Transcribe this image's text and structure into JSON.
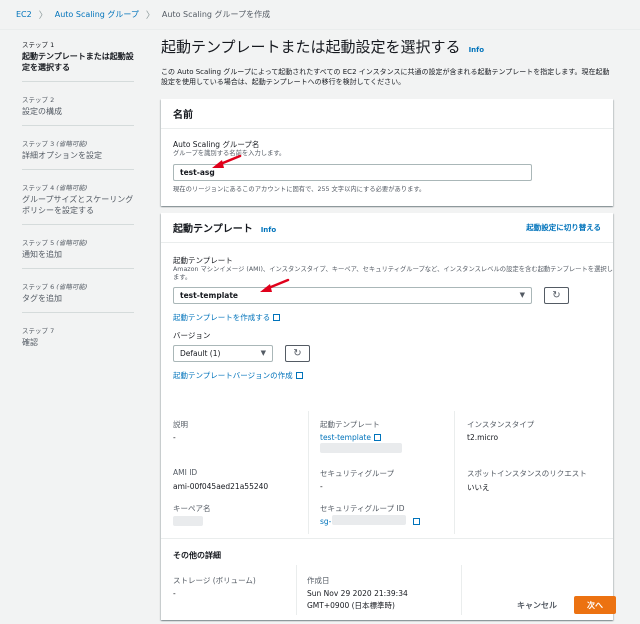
{
  "breadcrumb": {
    "items": [
      "EC2",
      "Auto Scaling グループ"
    ],
    "current": "Auto Scaling グループを作成"
  },
  "steps": [
    {
      "num": "ステップ 1",
      "optional": "",
      "title": "起動テンプレートまたは起動設定を選択する"
    },
    {
      "num": "ステップ 2",
      "optional": "",
      "title": "設定の構成"
    },
    {
      "num": "ステップ 3",
      "optional": "(省略可能)",
      "title": "詳細オプションを設定"
    },
    {
      "num": "ステップ 4",
      "optional": "(省略可能)",
      "title": "グループサイズとスケーリングポリシーを設定する"
    },
    {
      "num": "ステップ 5",
      "optional": "(省略可能)",
      "title": "通知を追加"
    },
    {
      "num": "ステップ 6",
      "optional": "(省略可能)",
      "title": "タグを追加"
    },
    {
      "num": "ステップ 7",
      "optional": "",
      "title": "確認"
    }
  ],
  "page": {
    "title": "起動テンプレートまたは起動設定を選択する",
    "info": "Info",
    "description": "この Auto Scaling グループによって起動されたすべての EC2 インスタンスに共通の設定が含まれる起動テンプレートを指定します。現在起動設定を使用している場合は、起動テンプレートへの移行を検討してください。"
  },
  "name_card": {
    "header": "名前",
    "label": "Auto Scaling グループ名",
    "hint": "グループを識別する名前を入力します。",
    "value": "test-asg",
    "constraint": "現在のリージョンにあるこのアカウントに固有で、255 文字以内にする必要があります。"
  },
  "template_card": {
    "header": "起動テンプレート",
    "info": "Info",
    "switch_link": "起動設定に切り替える",
    "label": "起動テンプレート",
    "hint": "Amazon マシンイメージ (AMI)、インスタンスタイプ、キーペア、セキュリティグループなど、インスタンスレベルの設定を含む起動テンプレートを選択します。",
    "selected": "test-template",
    "create_link": "起動テンプレートを作成する",
    "version_label": "バージョン",
    "version_selected": "Default (1)",
    "create_version_link": "起動テンプレートバージョンの作成",
    "details": {
      "description_label": "説明",
      "description_value": "-",
      "template_label": "起動テンプレート",
      "template_value": "test-template",
      "instance_type_label": "インスタンスタイプ",
      "instance_type_value": "t2.micro",
      "ami_label": "AMI ID",
      "ami_value": "ami-00f045aed21a55240",
      "sg_label": "セキュリティグループ",
      "sg_value": "-",
      "spot_label": "スポットインスタンスのリクエスト",
      "spot_value": "いいえ",
      "key_label": "キーペア名",
      "sgid_label": "セキュリティグループ ID",
      "sgid_value": "sg-"
    },
    "other_header": "その他の詳細",
    "storage_label": "ストレージ (ボリューム)",
    "storage_value": "-",
    "created_label": "作成日",
    "created_value_1": "Sun Nov 29 2020 21:39:34",
    "created_value_2": "GMT+0900 (日本標準時)"
  },
  "footer": {
    "cancel": "キャンセル",
    "next": "次へ"
  },
  "colors": {
    "accent": "#0073bb",
    "primary_button": "#ec7211",
    "annotation_arrow": "#e0001b"
  }
}
